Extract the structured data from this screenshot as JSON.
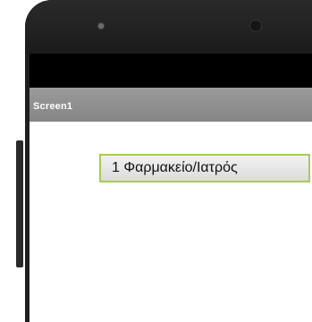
{
  "app": {
    "screen_title": "Screen1"
  },
  "main": {
    "button_label": "1 Φαρμακείο/Ιατρός"
  },
  "colors": {
    "button_border": "#a9cc52",
    "title_bar": "#8d8d8d",
    "status_bar": "#000000",
    "phone_body": "#1f1f1f"
  }
}
